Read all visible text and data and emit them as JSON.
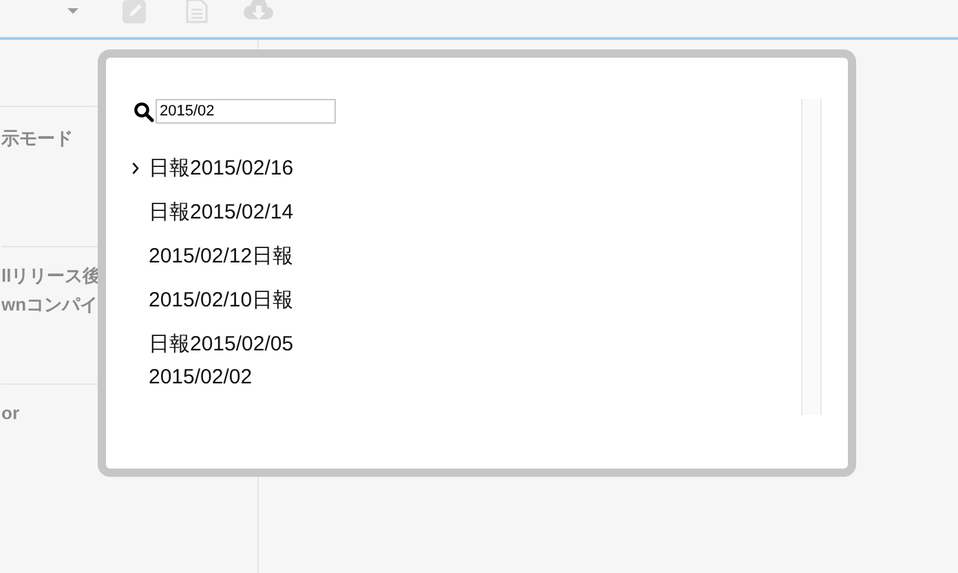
{
  "toolbar": {
    "buttons": [
      {
        "kind": "caret"
      },
      {
        "kind": "pencil"
      },
      {
        "kind": "document"
      },
      {
        "kind": "cloud-download"
      }
    ]
  },
  "sidebar": {
    "items": [
      {
        "lines": [
          "示モード"
        ]
      },
      {
        "lines": [
          "llリリース後",
          "wnコンパイ"
        ]
      },
      {
        "lines": [
          "or"
        ]
      }
    ]
  },
  "dialog": {
    "search": {
      "value": "2015/02"
    },
    "results": [
      {
        "label": "日報2015/02/16",
        "selected": true
      },
      {
        "label": "日報2015/02/14",
        "selected": false
      },
      {
        "label": "2015/02/12日報",
        "selected": false
      },
      {
        "label": "2015/02/10日報",
        "selected": false
      },
      {
        "label": "日報2015/02/05",
        "selected": false
      },
      {
        "label": "2015/02/02",
        "selected": false
      }
    ]
  }
}
